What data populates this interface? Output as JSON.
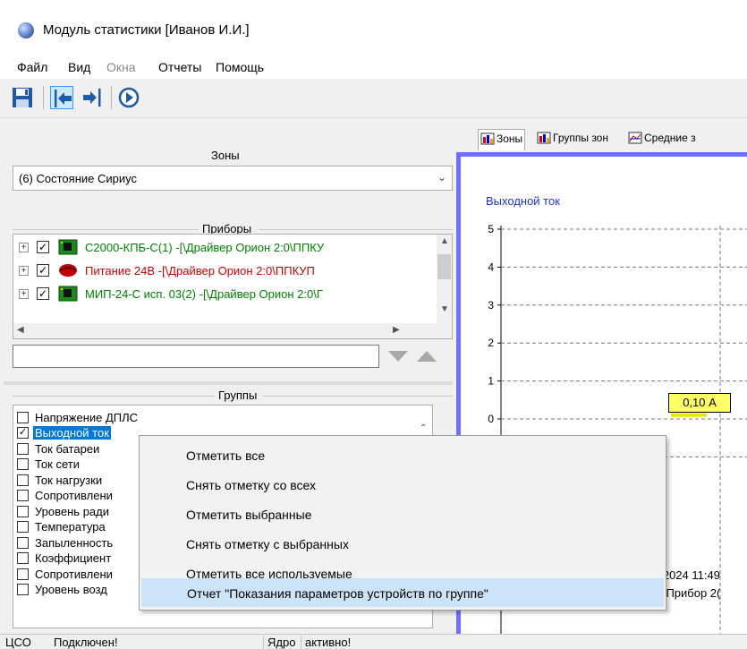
{
  "window": {
    "title": "Модуль статистики [Иванов И.И.]"
  },
  "menu": [
    {
      "label": "Файл",
      "enabled": true
    },
    {
      "label": "Вид",
      "enabled": true
    },
    {
      "label": "Окна",
      "enabled": false
    },
    {
      "label": "Отчеты",
      "enabled": true
    },
    {
      "label": "Помощь",
      "enabled": true
    }
  ],
  "toolbar": {
    "icons": [
      "save-icon",
      "arrow-left-icon",
      "arrow-right-icon",
      "play-icon"
    ]
  },
  "zones": {
    "caption": "Зоны",
    "selected": "(6) Состояние Сириус"
  },
  "devices": {
    "caption": "Приборы",
    "items": [
      {
        "label": "С2000-КПБ-С(1) -[\\Драйвер Орион 2:0\\ППКУ",
        "color": "#008000",
        "checked": true,
        "icon": "board-icon"
      },
      {
        "label": "Питание 24В -[\\Драйвер Орион 2:0\\ППКУП",
        "color": "#cc0000",
        "checked": true,
        "icon": "power-icon"
      },
      {
        "label": "МИП-24-С исп. 03(2) -[\\Драйвер Орион 2:0\\Г",
        "color": "#008000",
        "checked": true,
        "icon": "board-icon"
      }
    ]
  },
  "filter": {
    "value": ""
  },
  "groups": {
    "caption": "Группы",
    "items": [
      {
        "label": "Напряжение ДПЛС",
        "checked": false,
        "selected": false
      },
      {
        "label": "Выходной ток",
        "checked": true,
        "selected": true
      },
      {
        "label": "Ток батареи",
        "checked": false,
        "selected": false
      },
      {
        "label": "Ток сети",
        "checked": false,
        "selected": false
      },
      {
        "label": "Ток нагрузки",
        "checked": false,
        "selected": false
      },
      {
        "label": "Сопротивлени",
        "checked": false,
        "selected": false
      },
      {
        "label": "Уровень ради",
        "checked": false,
        "selected": false
      },
      {
        "label": "Температура",
        "checked": false,
        "selected": false
      },
      {
        "label": "Запыленность",
        "checked": false,
        "selected": false
      },
      {
        "label": "Коэффициент",
        "checked": false,
        "selected": false
      },
      {
        "label": "Сопротивлени",
        "checked": false,
        "selected": false
      },
      {
        "label": "Уровень возд",
        "checked": false,
        "selected": false
      }
    ]
  },
  "tabs": [
    {
      "label": "Зоны",
      "icon": "bar-chart-icon"
    },
    {
      "label": "Группы зон",
      "icon": "bar-chart-icon"
    },
    {
      "label": "Средние з",
      "icon": "avg-chart-icon"
    }
  ],
  "chart": {
    "label": "Выходной ток",
    "value_box": "0,10 А",
    "fragment_1": "8.2024 11:49",
    "fragment_2": "3, Прибор 2("
  },
  "chart_data": {
    "type": "line",
    "title": "Выходной ток",
    "ylim": [
      -1,
      5
    ],
    "yticks": [
      "5",
      "4",
      "3",
      "2",
      "1",
      "0",
      "-1"
    ],
    "series": [
      {
        "values": [
          0.1
        ]
      }
    ],
    "annotations": [
      "0,10 А"
    ],
    "grid": true
  },
  "context_menu": {
    "items": [
      "Отметить все",
      "Снять отметку со всех",
      "Отметить выбранные",
      "Снять отметку с выбранных",
      "Отметить все используемые",
      "Отчет \"Показания параметров устройств по группе\""
    ]
  },
  "status": {
    "cso": "ЦСО",
    "connection": "Подключен!",
    "core": "Ядро",
    "core_state": "активно!"
  }
}
